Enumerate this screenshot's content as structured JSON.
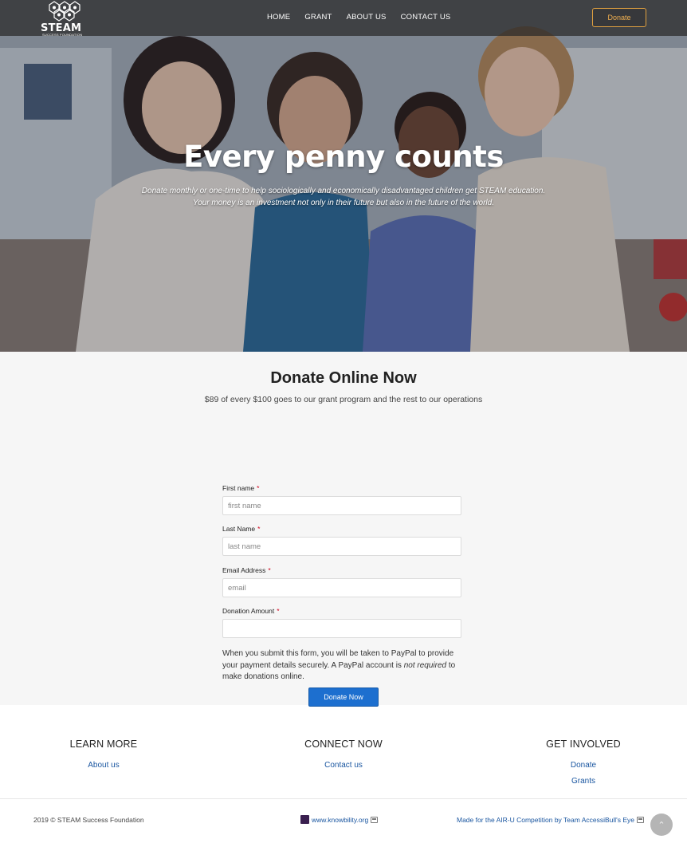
{
  "header": {
    "logo_text": "STEAM",
    "logo_subtext": "SUCCESS FOUNDATION",
    "nav": [
      "HOME",
      "GRANT",
      "ABOUT US",
      "CONTACT US"
    ],
    "donate_button": "Donate"
  },
  "hero": {
    "title": "Every penny counts",
    "subtitle_line1": "Donate monthly or one-time to help sociologically and economically disadvantaged children get STEAM education.",
    "subtitle_line2": "Your money is an investment not only in their future but also in the future of the world."
  },
  "donate_form": {
    "title": "Donate Online Now",
    "note": "$89 of every $100 goes to our grant program and the rest to our operations",
    "fields": [
      {
        "label": "First name",
        "required": "*",
        "placeholder": "first name",
        "value": ""
      },
      {
        "label": "Last Name",
        "required": "*",
        "placeholder": "last name",
        "value": ""
      },
      {
        "label": "Email Address",
        "required": "*",
        "placeholder": "email",
        "value": ""
      },
      {
        "label": "Donation Amount",
        "required": "*",
        "placeholder": "",
        "value": ""
      }
    ],
    "paypal_note_part1": "When you submit this form, you will be taken to PayPal to provide your payment details securely. A PayPal account is ",
    "paypal_note_emphasis": "not required",
    "paypal_note_part2": " to make donations online.",
    "submit_label": "Donate Now"
  },
  "footer": {
    "columns": [
      {
        "heading": "LEARN MORE",
        "links": [
          "About us"
        ]
      },
      {
        "heading": "CONNECT NOW",
        "links": [
          "Contact us"
        ]
      },
      {
        "heading": "GET INVOLVED",
        "links": [
          "Donate",
          "Grants"
        ]
      }
    ],
    "copyright": "2019 © STEAM Success Foundation",
    "knowbility_link": "www.knowbility.org",
    "credit_link": "Made for the AIR-U Competition by Team AccessiBull's Eye"
  },
  "colors": {
    "accent_orange": "#f0b050",
    "primary_blue": "#1d6fcf",
    "link_blue": "#1a56a0",
    "required_red": "#d0021b"
  },
  "icons": [
    "steam-logo-icon",
    "external-link-icon",
    "knowbility-logo-icon",
    "scroll-top-icon"
  ]
}
